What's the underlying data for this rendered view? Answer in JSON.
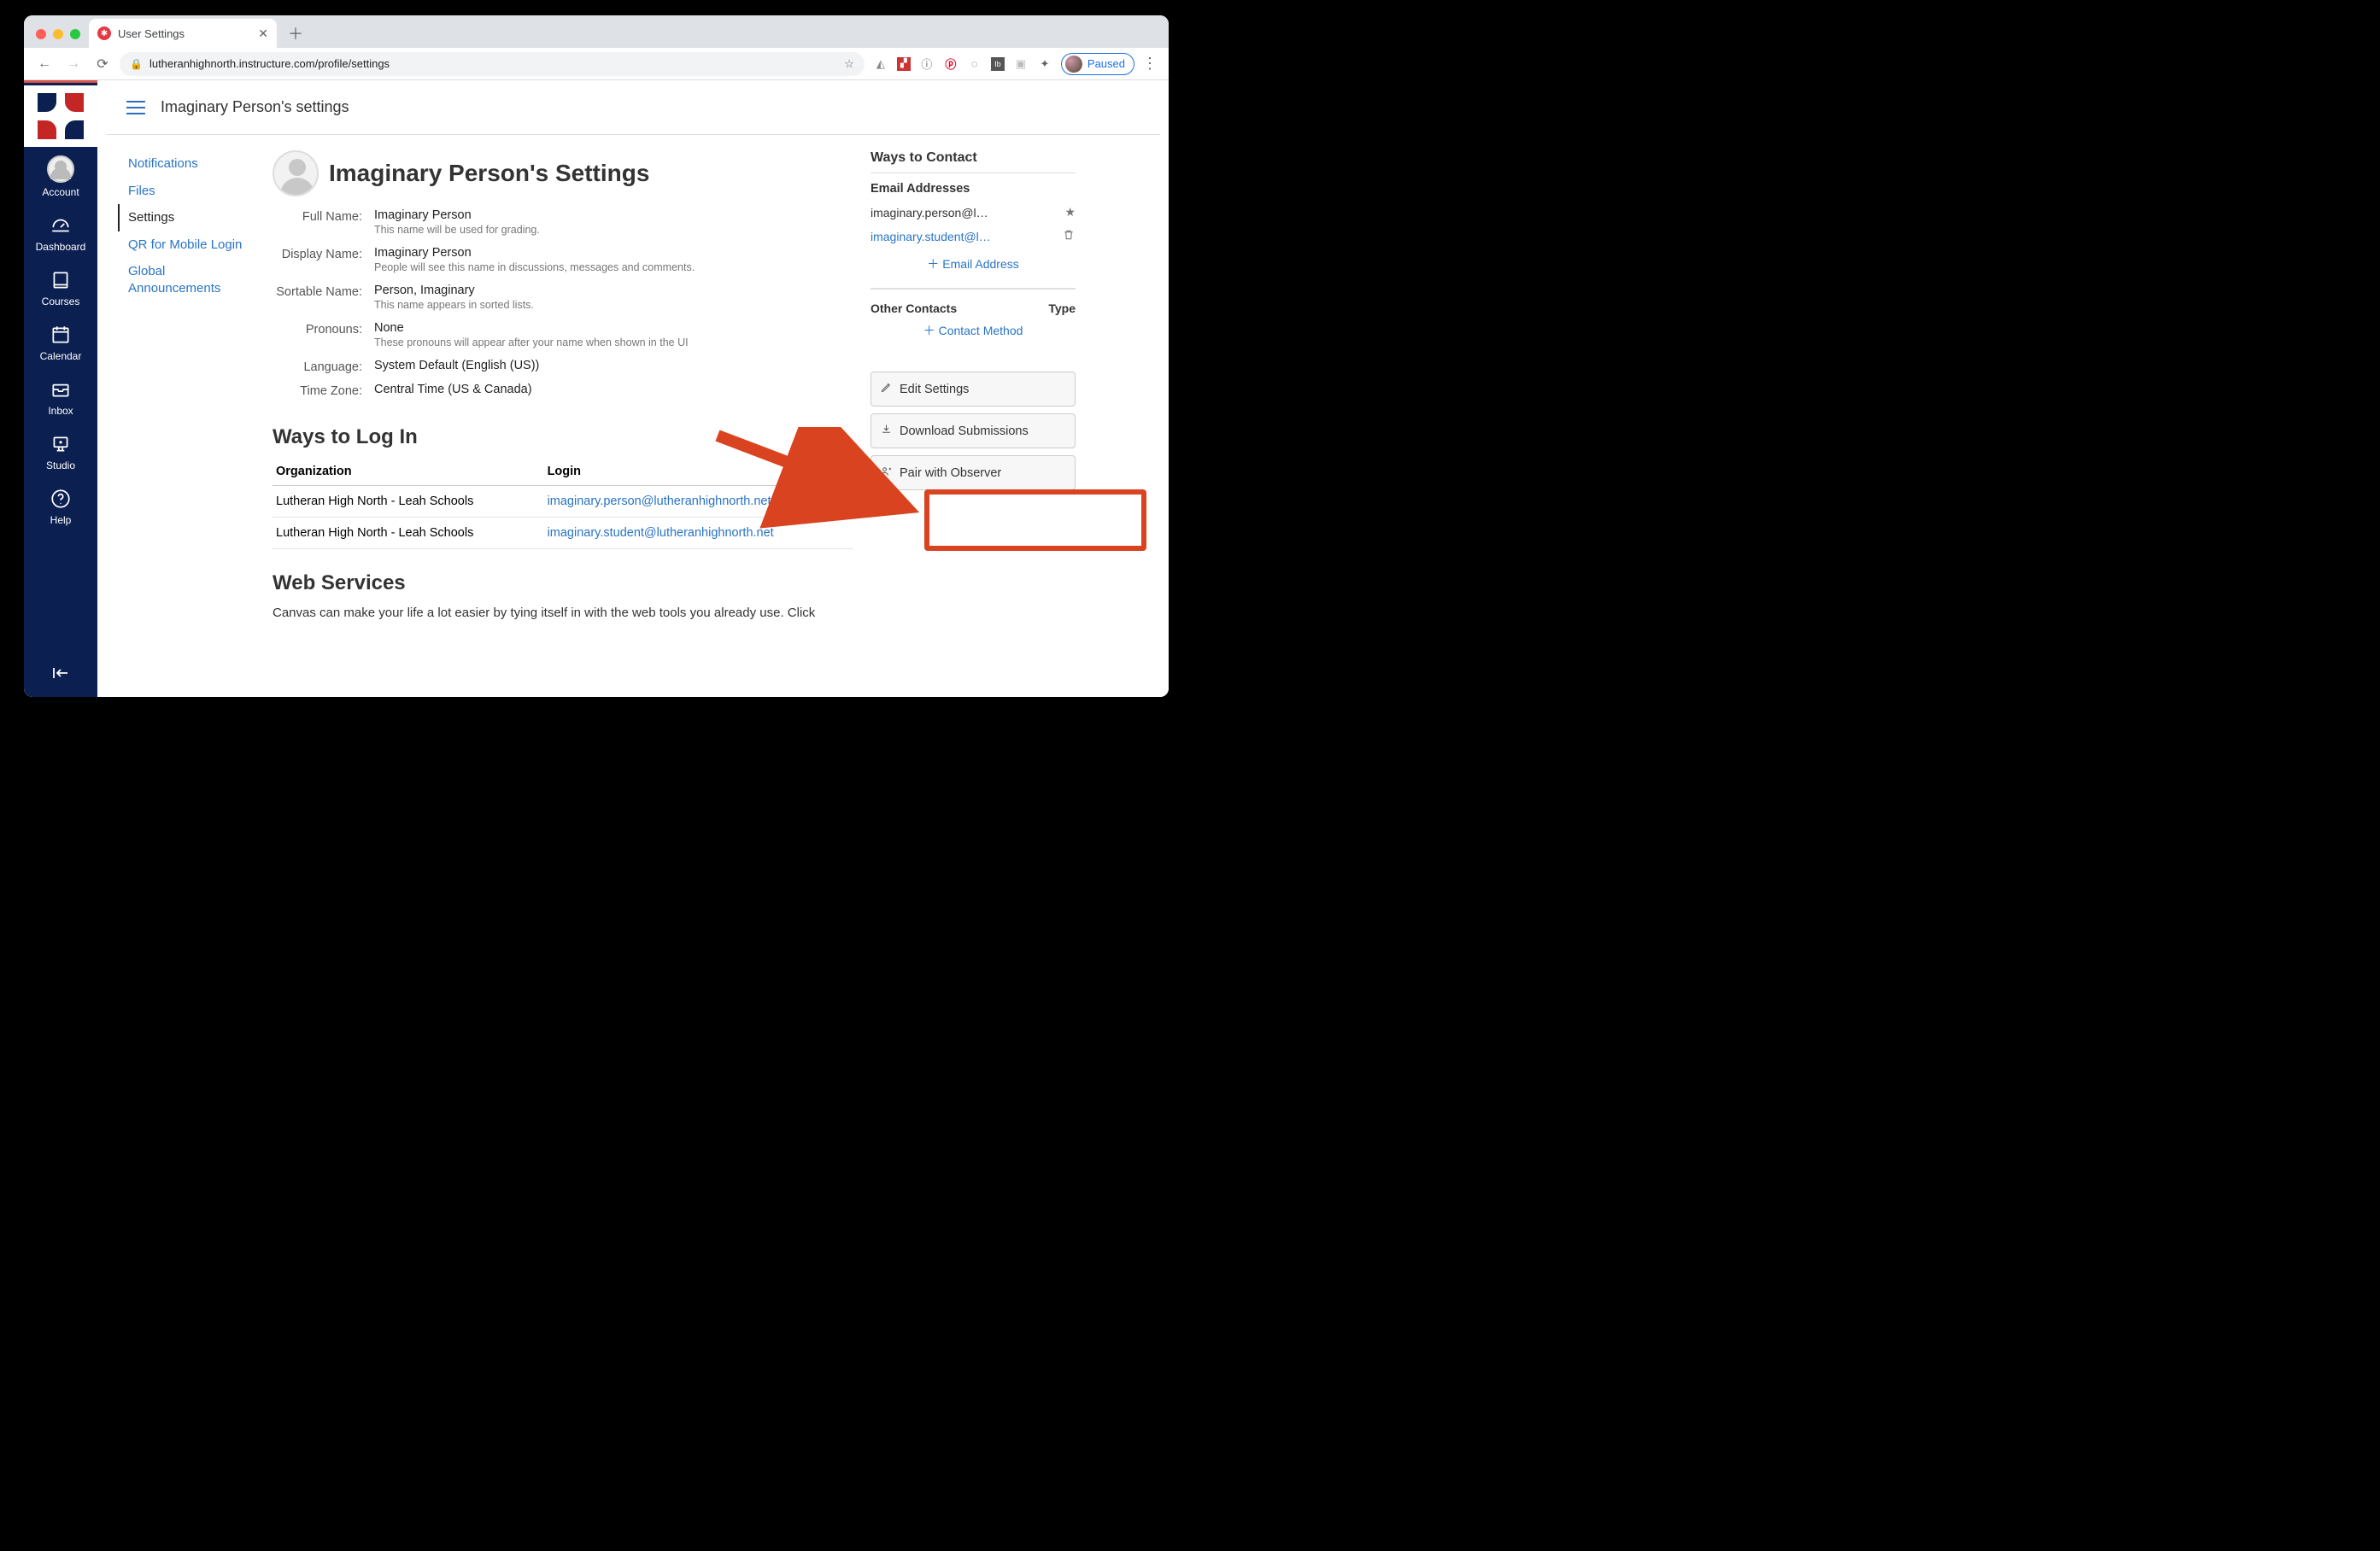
{
  "browser": {
    "tab_title": "User Settings",
    "url_display": "lutheranhighnorth.instructure.com/profile/settings",
    "profile_status": "Paused"
  },
  "nav": {
    "account": "Account",
    "dashboard": "Dashboard",
    "courses": "Courses",
    "calendar": "Calendar",
    "inbox": "Inbox",
    "studio": "Studio",
    "help": "Help"
  },
  "crumb": "Imaginary Person's settings",
  "left_menu": {
    "notifications": "Notifications",
    "files": "Files",
    "settings": "Settings",
    "qr": "QR for Mobile Login",
    "global_ann": "Global Announcements"
  },
  "main_heading": "Imaginary Person's Settings",
  "fields": {
    "full_name_label": "Full Name:",
    "full_name_val": "Imaginary Person",
    "full_name_help": "This name will be used for grading.",
    "display_name_label": "Display Name:",
    "display_name_val": "Imaginary Person",
    "display_name_help": "People will see this name in discussions, messages and comments.",
    "sortable_name_label": "Sortable Name:",
    "sortable_name_val": "Person, Imaginary",
    "sortable_name_help": "This name appears in sorted lists.",
    "pronouns_label": "Pronouns:",
    "pronouns_val": "None",
    "pronouns_help": "These pronouns will appear after your name when shown in the UI",
    "language_label": "Language:",
    "language_val": "System Default (English (US))",
    "tz_label": "Time Zone:",
    "tz_val": "Central Time (US & Canada)"
  },
  "login_section": {
    "heading": "Ways to Log In",
    "col_org": "Organization",
    "col_login": "Login",
    "rows": [
      {
        "org": "Lutheran High North - Leah Schools",
        "login": "imaginary.person@lutheranhighnorth.net"
      },
      {
        "org": "Lutheran High North - Leah Schools",
        "login": "imaginary.student@lutheranhighnorth.net"
      }
    ]
  },
  "web_services": {
    "heading": "Web Services",
    "body": "Canvas can make your life a lot easier by tying itself in with the web tools you already use. Click"
  },
  "right": {
    "ways_heading": "Ways to Contact",
    "emails_heading": "Email Addresses",
    "email1": "imaginary.person@l…",
    "email2": "imaginary.student@l…",
    "add_email": "Email Address",
    "other_contacts": "Other Contacts",
    "type": "Type",
    "add_contact": "Contact Method",
    "edit_settings": "Edit Settings",
    "download_subs": "Download Submissions",
    "pair_observer": "Pair with Observer"
  }
}
